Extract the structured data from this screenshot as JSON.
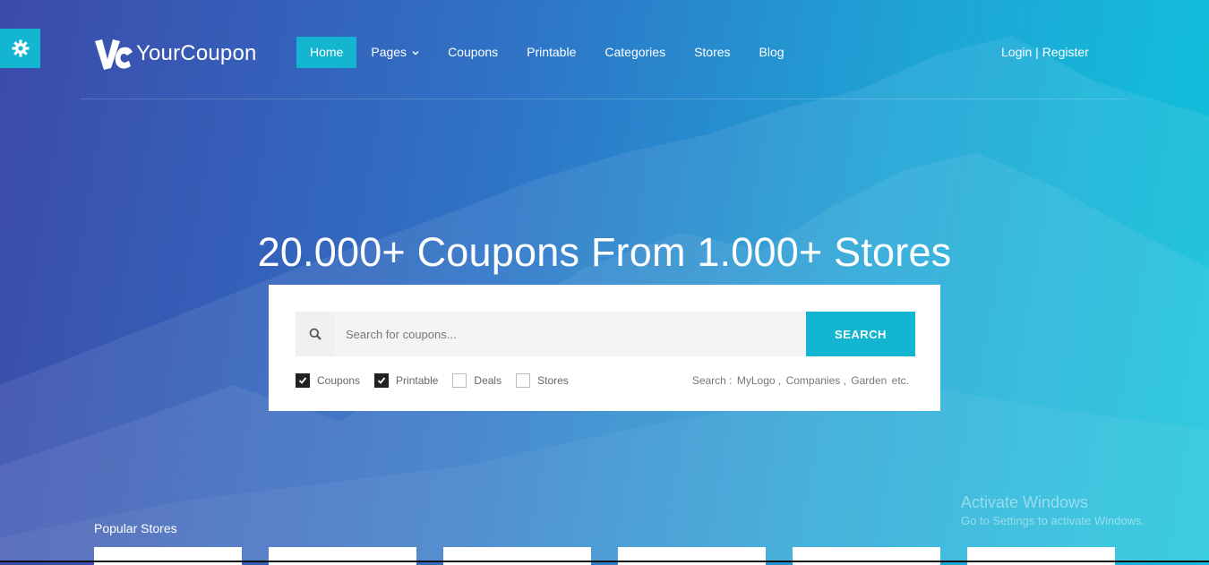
{
  "brand": {
    "name": "YourCoupon",
    "mark": "YC"
  },
  "nav": {
    "items": [
      {
        "label": "Home",
        "active": true
      },
      {
        "label": "Pages",
        "has_dropdown": true
      },
      {
        "label": "Coupons"
      },
      {
        "label": "Printable"
      },
      {
        "label": "Categories"
      },
      {
        "label": "Stores"
      },
      {
        "label": "Blog"
      }
    ]
  },
  "auth": {
    "login": "Login",
    "separator": "|",
    "register": "Register"
  },
  "hero": {
    "title": "20.000+ Coupons From 1.000+ Stores"
  },
  "search": {
    "placeholder": "Search for coupons...",
    "button": "SEARCH",
    "filters": [
      {
        "label": "Coupons",
        "checked": true
      },
      {
        "label": "Printable",
        "checked": true
      },
      {
        "label": "Deals",
        "checked": false
      },
      {
        "label": "Stores",
        "checked": false
      }
    ],
    "hints": {
      "prefix": "Search :",
      "items": [
        "MyLogo ,",
        "Companies ,",
        "Garden",
        "etc."
      ]
    }
  },
  "popular": {
    "title": "Popular Stores"
  },
  "watermark": {
    "line1": "Activate Windows",
    "line2": "Go to Settings to activate Windows."
  },
  "colors": {
    "accent": "#13b5d1",
    "bg_start": "#3c4aaa",
    "bg_end": "#10c3db"
  },
  "icons": {
    "settings": "gear-icon",
    "search": "search-icon",
    "dropdown": "chevron-down-icon",
    "check": "check-icon"
  }
}
